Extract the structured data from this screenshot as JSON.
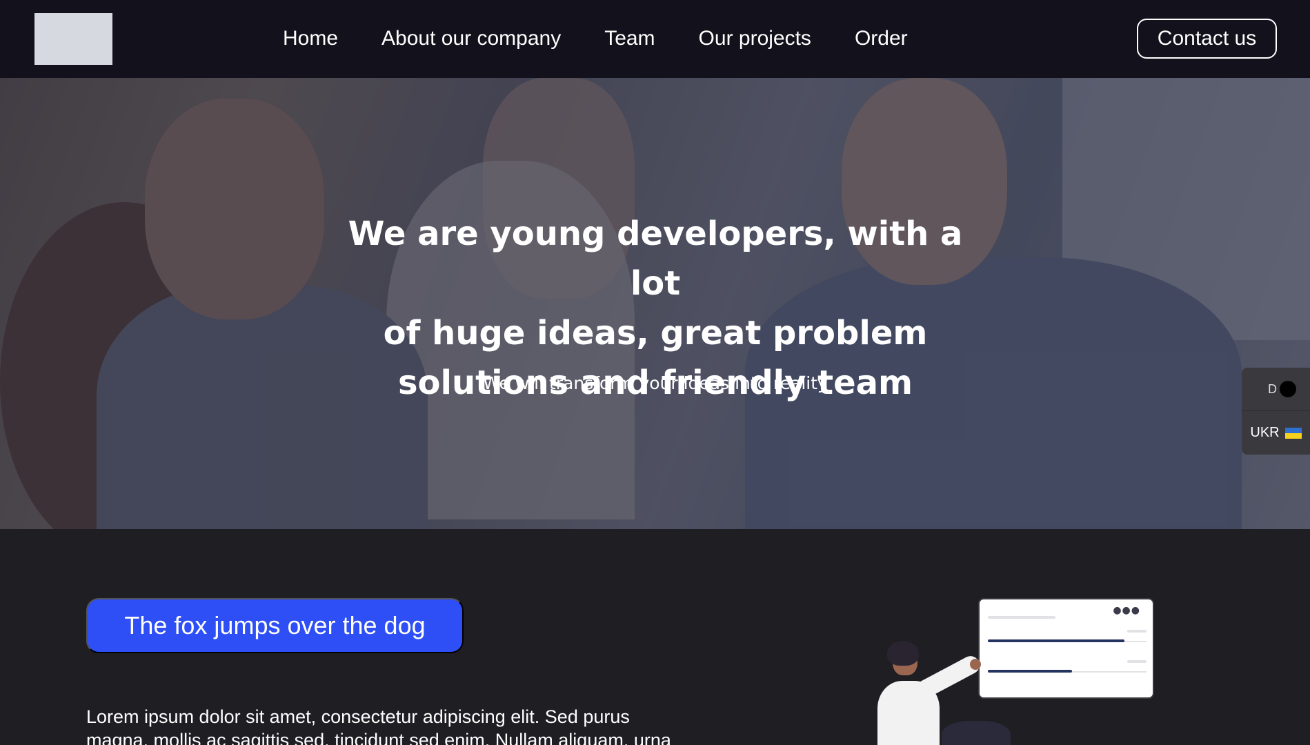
{
  "header": {
    "nav": [
      "Home",
      "About our company",
      "Team",
      "Our projects",
      "Order"
    ],
    "contact_label": "Contact us"
  },
  "hero": {
    "title_lines": [
      "We are young developers, with a lot",
      "of huge ideas, great problem",
      "solutions and friendly team"
    ],
    "subtitle": "We will transform your ideas into reality"
  },
  "side_widget": {
    "theme_label": "D",
    "language_label": "UKR"
  },
  "section": {
    "cta_label": "The fox jumps over the dog",
    "body_line_1": "Lorem ipsum dolor sit amet, consectetur adipiscing elit. Sed purus",
    "body_line_2": "magna, mollis ac sagittis sed, tincidunt sed enim. Nullam aliquam, urna"
  },
  "colors": {
    "header_bg": "#13121c",
    "page_bg": "#1f1e23",
    "accent": "#2e4ff5"
  }
}
